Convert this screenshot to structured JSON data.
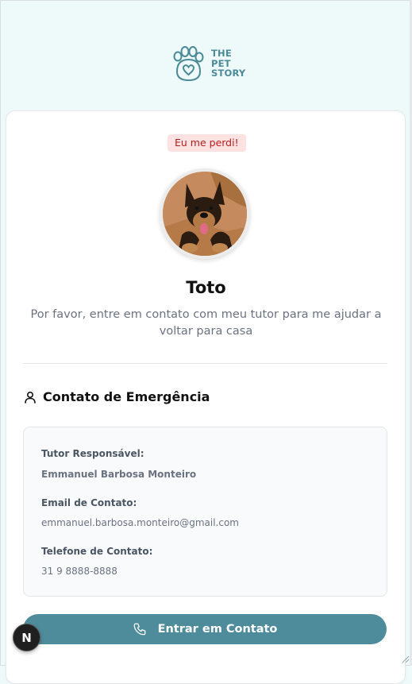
{
  "brand": {
    "line1": "THE",
    "line2": "PET",
    "line3": "STORY",
    "color": "#4b8a96"
  },
  "status_badge": "Eu me perdi!",
  "pet": {
    "name": "Toto",
    "message": "Por favor, entre em contato com meu tutor para me ajudar a voltar para casa"
  },
  "emergency": {
    "title": "Contato de Emergência",
    "tutor_label": "Tutor Responsável:",
    "tutor_value": "Emmanuel Barbosa Monteiro",
    "email_label": "Email de Contato:",
    "email_value": "emmanuel.barbosa.monteiro@gmail.com",
    "phone_label": "Telefone de Contato:",
    "phone_value": "31 9 8888-8888"
  },
  "contact_button": {
    "label": "Entrar em Contato",
    "color": "#4f8c9b"
  },
  "dev_badge": "N"
}
